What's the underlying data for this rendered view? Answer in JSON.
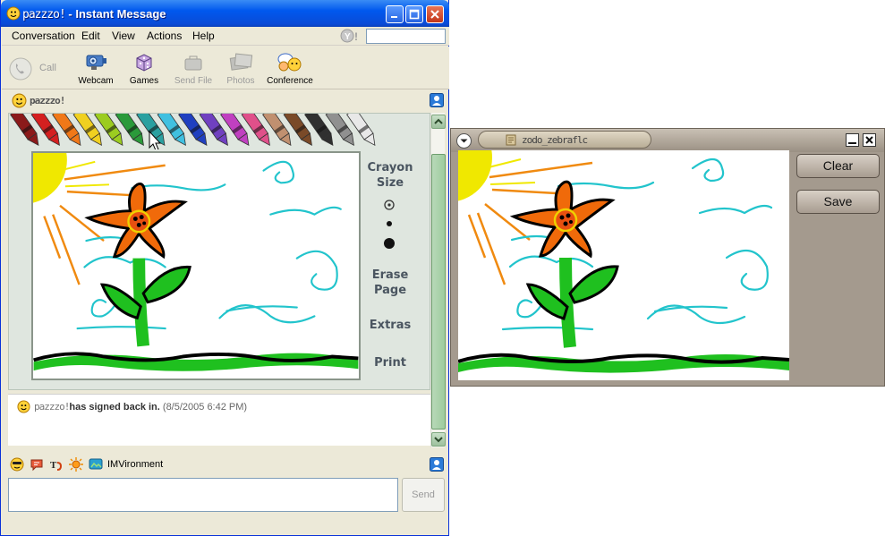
{
  "im_window": {
    "title_user": "pazzzo!",
    "title_suffix": "- Instant Message",
    "menu": [
      "Conversation",
      "Edit",
      "View",
      "Actions",
      "Help"
    ],
    "toolbar": [
      {
        "label": "Call",
        "icon": "phone-icon",
        "enabled": false
      },
      {
        "label": "Webcam",
        "icon": "webcam-icon",
        "enabled": true
      },
      {
        "label": "Games",
        "icon": "dice-icon",
        "enabled": true
      },
      {
        "label": "Send File",
        "icon": "send-file-icon",
        "enabled": false
      },
      {
        "label": "Photos",
        "icon": "photos-icon",
        "enabled": false
      },
      {
        "label": "Conference",
        "icon": "conference-icon",
        "enabled": true
      }
    ],
    "contact_name": "pazzzo!",
    "doodle_panel": {
      "crayon_size_label": "Crayon Size",
      "erase_label": "Erase Page",
      "extras_label": "Extras",
      "print_label": "Print",
      "crayon_colors": [
        "#8b1a1a",
        "#d42020",
        "#f07818",
        "#f0d020",
        "#9ccc20",
        "#2a9a3a",
        "#2aa0a0",
        "#40c0e0",
        "#2040c0",
        "#7040c0",
        "#c040c0",
        "#e0508a",
        "#c09070",
        "#7a4a28",
        "#303030",
        "#909090",
        "#e8e8e8"
      ]
    },
    "history": {
      "user": "pazzzo!",
      "message": "has signed back in.",
      "time": "(8/5/2005 6:42 PM)"
    },
    "bottom_bar": {
      "imvironment_label": "IMVironment"
    },
    "send_label": "Send"
  },
  "popout_window": {
    "tab_text": "zodo_zebraflc",
    "clear_label": "Clear",
    "save_label": "Save"
  },
  "colors": {
    "xp_blue": "#0058ee",
    "panel_green": "#dfe6df",
    "popout_frame": "#a49a8e",
    "sun_yellow": "#f0e800",
    "flower_orange": "#f06a0a",
    "stem_green": "#1fc01f",
    "wind_cyan": "#22c4cc"
  }
}
